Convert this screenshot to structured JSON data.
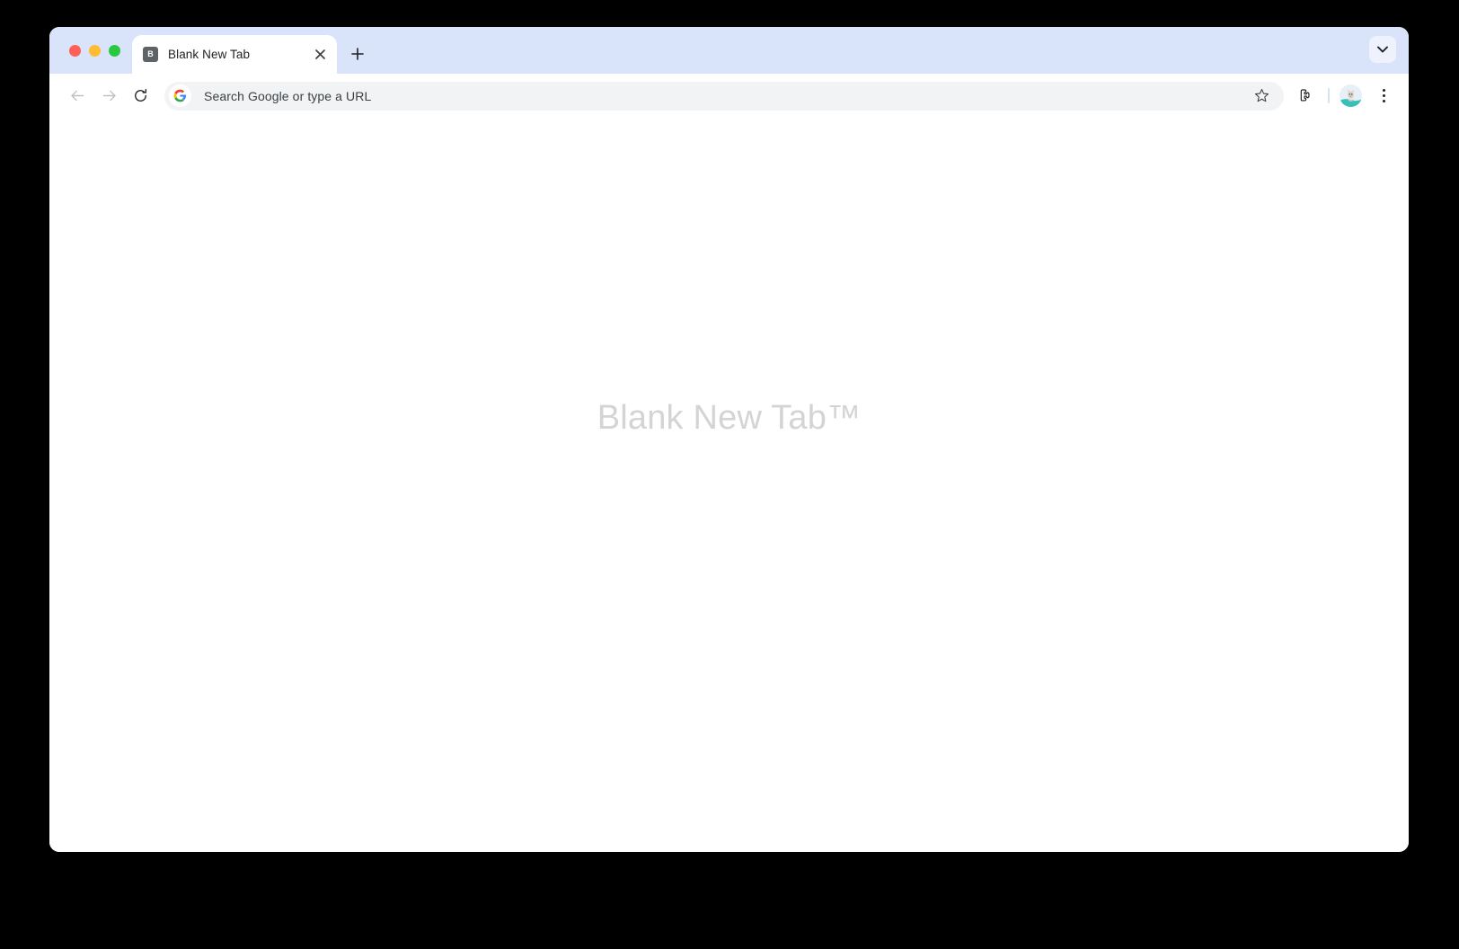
{
  "window": {
    "traffic_lights": [
      {
        "name": "close",
        "color": "#ff5f57"
      },
      {
        "name": "minimize",
        "color": "#febc2e"
      },
      {
        "name": "maximize",
        "color": "#28c840"
      }
    ],
    "tab_strip_color": "#d9e3fa"
  },
  "tab_strip": {
    "tabs": [
      {
        "title": "Blank New Tab",
        "favicon_letter": "B",
        "favicon_bg": "#5f6368",
        "active": true,
        "close_label": "×"
      }
    ],
    "new_tab_label": "+",
    "tab_search_label": "⌄"
  },
  "toolbar": {
    "back_label": "←",
    "forward_label": "→",
    "reload_label": "⟳",
    "omnibox": {
      "value": "",
      "placeholder": "Search Google or type a URL",
      "search_engine": "Google"
    },
    "bookmark_label": "☆",
    "extensions_label": "Extensions",
    "profile_label": "Profile",
    "menu_label": "⋮"
  },
  "page": {
    "heading": "Blank New Tab™",
    "heading_color": "#d4d4d4",
    "background": "#ffffff"
  }
}
